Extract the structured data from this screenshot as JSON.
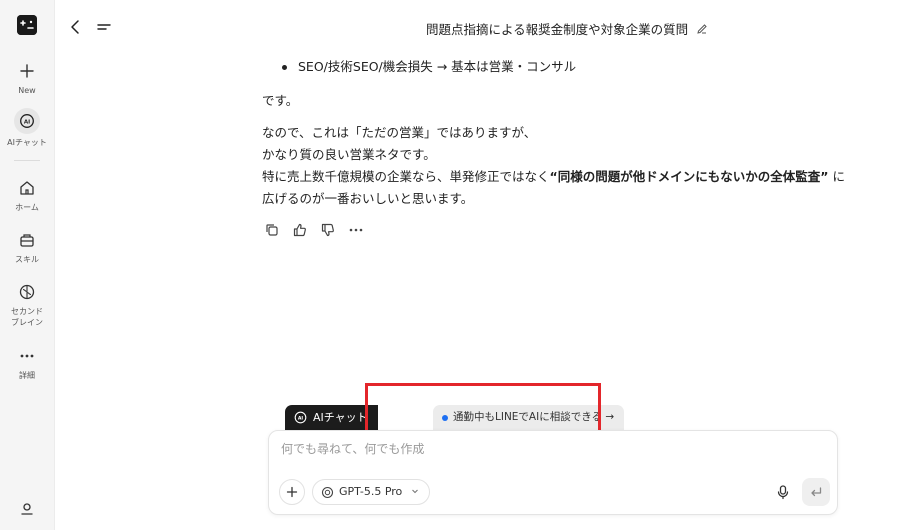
{
  "sidebar": {
    "logo": "app-logo",
    "items": [
      {
        "label": "New",
        "icon": "plus-icon"
      },
      {
        "label": "AIチャット",
        "icon": "ai-chat-icon"
      },
      {
        "label": "ホーム",
        "icon": "home-icon"
      },
      {
        "label": "スキル",
        "icon": "skill-icon"
      },
      {
        "label": "セカンド\nブレイン",
        "label1": "セカンド",
        "label2": "ブレイン",
        "icon": "brain-icon"
      },
      {
        "label": "詳細",
        "icon": "more-icon"
      }
    ],
    "profile_icon": "user-icon"
  },
  "header": {
    "title": "問題点指摘による報奨金制度や対象企業の質問"
  },
  "message": {
    "bullet": "SEO/技術SEO/機会損失 → 基本は営業・コンサル",
    "para1": "です。",
    "para2_line1": "なので、これは「ただの営業」ではありますが、",
    "para2_line2": "かなり質の良い営業ネタです。",
    "para2_line3_pre": "特に売上数千億規模の企業なら、単発修正ではなく",
    "para2_line3_bold": "“同様の問題が他ドメインにもないかの全体監査”",
    "para2_line3_post": "に",
    "para2_line4": "広げるのが一番おいしいと思います。"
  },
  "chips": {
    "ai_chat": "AIチャット",
    "promo": "通勤中もLINEでAIに相談できる →"
  },
  "composer": {
    "placeholder": "何でも尋ねて、何でも作成",
    "model": "GPT-5.5 Pro"
  },
  "colors": {
    "highlight": "#e3262b",
    "promo_dot": "#1d6ff2",
    "dark_chip": "#1c1c1c"
  }
}
